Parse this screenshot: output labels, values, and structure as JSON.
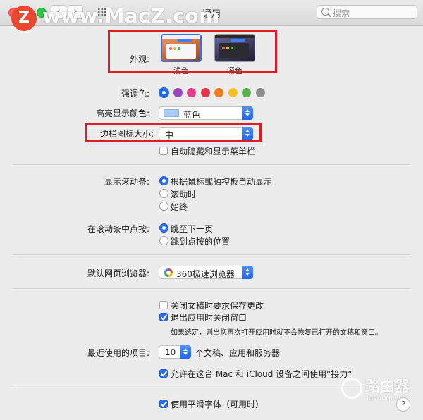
{
  "window": {
    "title": "通用"
  },
  "search": {
    "placeholder": "搜索"
  },
  "watermark": {
    "logo_letter": "Z",
    "text": "www.MacZ.com"
  },
  "appearance": {
    "label": "外观:",
    "light": "浅色",
    "dark": "深色"
  },
  "accent": {
    "label": "强调色:",
    "colors": [
      "#1f6bea",
      "#9b43be",
      "#e43d8b",
      "#e8344a",
      "#f27b1b",
      "#f8bf23",
      "#5ab24a",
      "#8e8e8e"
    ],
    "selected": 0
  },
  "highlight": {
    "label": "高亮显示颜色:",
    "value": "蓝色"
  },
  "sidebar_icon": {
    "label": "边栏图标大小:",
    "value": "中"
  },
  "auto_hide_menu": {
    "label": "自动隐藏和显示菜单栏",
    "checked": false
  },
  "scrollbars": {
    "label": "显示滚动条:",
    "options": [
      "根据鼠标或触控板自动显示",
      "滚动时",
      "始终"
    ],
    "selected": 0
  },
  "scroll_click": {
    "label": "在滚动条中点按:",
    "options": [
      "跳至下一页",
      "跳到点按的位置"
    ],
    "selected": 0
  },
  "browser": {
    "label": "默认网页浏览器:",
    "value": "360极速浏览器"
  },
  "ask_save": {
    "label": "关闭文稿时要求保存更改",
    "checked": false
  },
  "close_windows": {
    "label": "退出应用时关闭窗口",
    "checked": true
  },
  "close_windows_note": "如果选定，则当您再次打开应用时就不会恢复已打开的文稿和窗口。",
  "recent": {
    "label": "最近使用的项目:",
    "value": "10",
    "suffix": "个文稿、应用和服务器"
  },
  "handoff": {
    "label": "允许在这台 Mac 和 iCloud 设备之间使用“接力”",
    "checked": true
  },
  "smoothing": {
    "label": "使用平滑字体（可用时）",
    "checked": true
  },
  "help": "?",
  "corner_watermark": {
    "title": "路由器",
    "subtitle": "luyouqi.com"
  }
}
